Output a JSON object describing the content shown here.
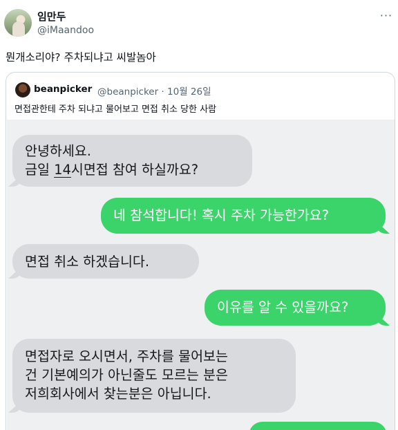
{
  "tweet": {
    "display_name": "임만두",
    "handle": "@iMaandoo",
    "more_icon": "more-dots-icon",
    "text": "뭔개소리야? 주차되냐고 씨발놈아"
  },
  "quote": {
    "display_name": "beanpicker",
    "handle_date": "@beanpicker · 10월 26일",
    "text": "면접관한테 주차 되냐고 물어보고 면접 취소 당한 사람"
  },
  "chat": {
    "messages": [
      {
        "from": "them",
        "lines": [
          "안녕하세요.",
          "금일 ",
          "14",
          "시면접 참여 하실까요?"
        ]
      },
      {
        "from": "me",
        "lines": [
          "네 참석합니다! 혹시 주차 가능한가요?"
        ]
      },
      {
        "from": "them",
        "lines": [
          "면접 취소 하겠습니다."
        ]
      },
      {
        "from": "me",
        "lines": [
          "이유를 알 수 있을까요?"
        ]
      },
      {
        "from": "them",
        "lines": [
          "면접자로 오시면서, 주차를 물어보는",
          "건 기본예의가 아닌줄도 모르는 분은",
          "저희회사에서 찾는분은 아닙니다."
        ]
      }
    ]
  }
}
